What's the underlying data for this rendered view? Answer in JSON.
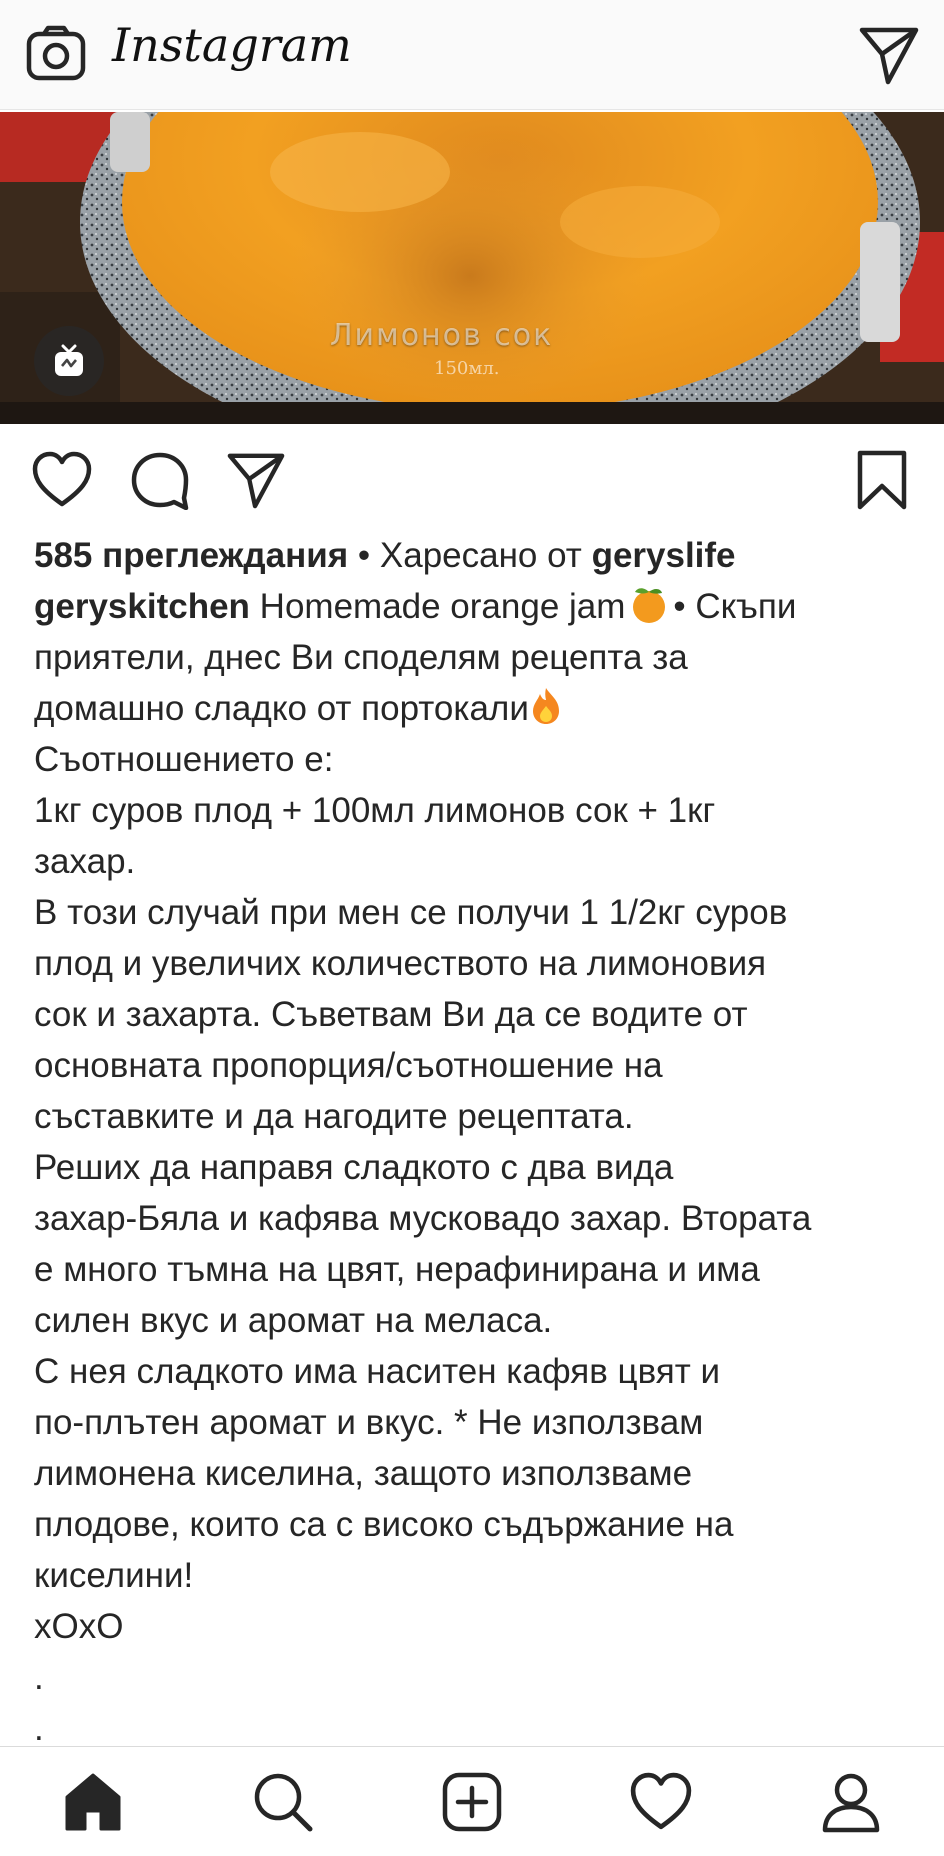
{
  "app": {
    "name": "Instagram",
    "accent": "#262626",
    "background": "#ffffff"
  },
  "topbar": {
    "logo_text": "Instagram",
    "camera_icon": "camera-icon",
    "direct_icon": "paper-plane-icon"
  },
  "media": {
    "overlay_text": "Лимонов сок",
    "overlay_sub": "150мл.",
    "badge_icon": "igtv-icon"
  },
  "actions": {
    "like_icon": "heart-icon",
    "comment_icon": "comment-icon",
    "share_icon": "paper-plane-icon",
    "save_icon": "bookmark-icon"
  },
  "post": {
    "views": "585 преглеждания",
    "liked_by_prefix": "• Харесано от ",
    "liked_by_user": "geryslife",
    "username": "geryskitchen",
    "caption_title": "Homemade orange jam",
    "caption_title_suffix": "• Скъпи",
    "lines": [
      "приятели, днес Ви споделям рецепта за",
      "домашно сладко от портокали",
      "Съотношението е:",
      "1кг суров плод + 100мл лимонов сок + 1кг",
      "захар.",
      "В този случай при мен се получи 1 1/2кг суров",
      "плод и увеличих количеството на лимоновия",
      "сок и захарта. Съветвам Ви да се водите от",
      "основната пропорция/съотношение на",
      "съставките и да нагодите рецептата.",
      "Реших да направя сладкото с два вида",
      "захар-Бяла и кафява мусковадо захар. Втората",
      "е много тъмна на цвят, нерафинирана и има",
      "силен вкус и аромат на меласа.",
      "С нея сладкото има наситен кафяв цвят и",
      "по-плътен аромат и вкус. * Не използвам",
      "лимонена киселина, защото използваме",
      "плодове, които са с високо съдържание на",
      "киселини!",
      "xOxO",
      ".",
      "."
    ]
  },
  "bottom_nav": {
    "items": [
      "home-icon",
      "search-icon",
      "add-post-icon",
      "activity-heart-icon",
      "profile-icon"
    ]
  }
}
